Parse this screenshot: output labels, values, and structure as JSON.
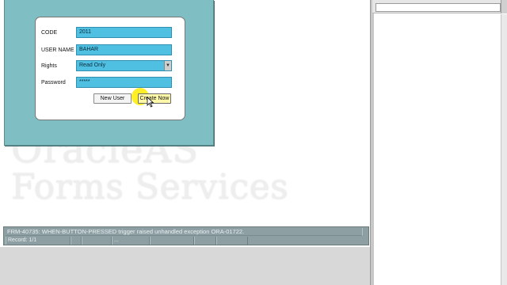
{
  "watermark": {
    "line1": "OracleAS",
    "line2": "Forms Services"
  },
  "form": {
    "code_label": "CODE",
    "code_value": "2011",
    "username_label": "USER NAME",
    "username_value": "BAHAR",
    "rights_label": "Rights",
    "rights_value": "Read Only",
    "password_label": "Password",
    "password_value": "*****",
    "new_user_button": "New User",
    "create_now_button": "Create Now"
  },
  "status": {
    "message": "FRM-40735: WHEN-BUTTON-PRESSED trigger raised unhandled exception ORA-01722.",
    "record": "Record: 1/1",
    "indicator": "..."
  },
  "colors": {
    "form_background": "#7fbfc4",
    "field_fill": "#4fc0e2",
    "status_bar": "#8e9fa3",
    "cursor_highlight": "#ffec00"
  }
}
